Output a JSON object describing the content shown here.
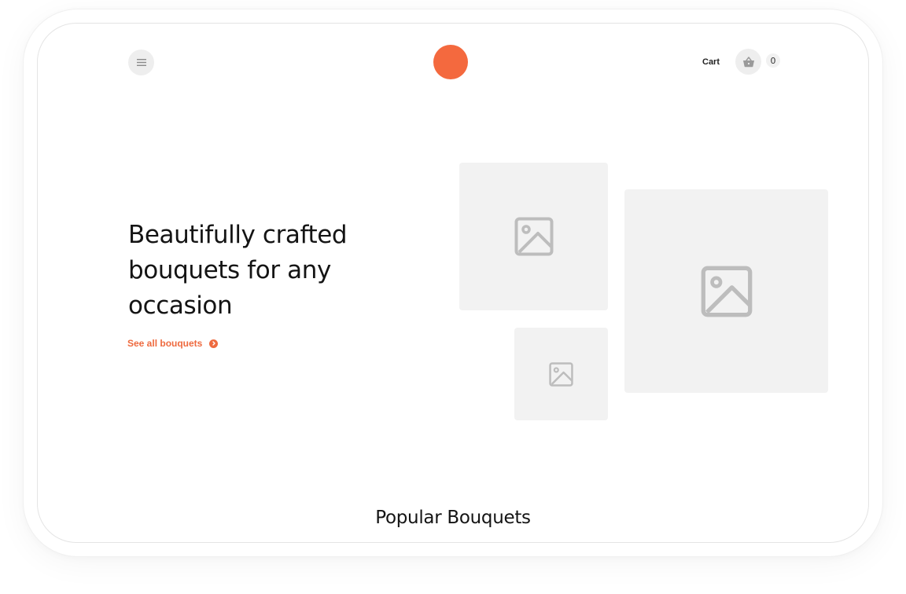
{
  "header": {
    "menu_icon": "hamburger-menu-icon",
    "logo_color": "#f4693e",
    "cart_label": "Cart",
    "cart_icon": "basket-icon",
    "cart_count": "0"
  },
  "hero": {
    "title": "Beautifully crafted bouquets for any occasion",
    "link_label": "See all bouquets",
    "link_icon": "chevron-right-circle-icon",
    "accent_color": "#ee6a3f",
    "image_placeholders": [
      {
        "icon": "image-placeholder-icon"
      },
      {
        "icon": "image-placeholder-icon"
      },
      {
        "icon": "image-placeholder-icon"
      }
    ]
  },
  "popular": {
    "title": "Popular Bouquets"
  }
}
